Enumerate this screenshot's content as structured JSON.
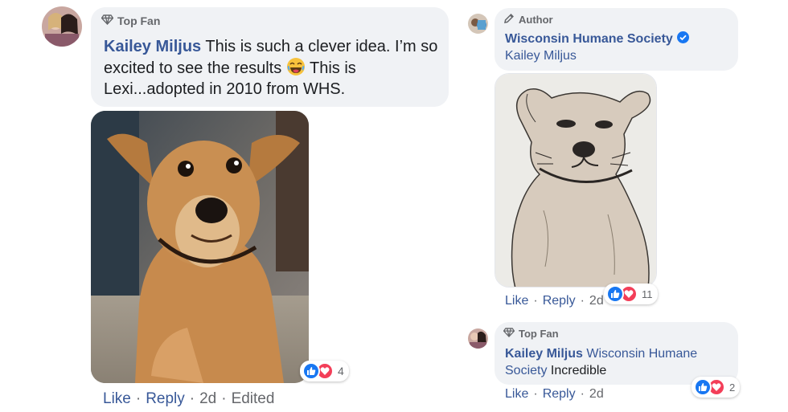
{
  "left_comment": {
    "badge": "Top Fan",
    "author": "Kailey Miljus",
    "text_part1": " This is such a clever idea. I’m so excited to see the results ",
    "text_part2": " This is Lexi...adopted in 2010 from WHS.",
    "emoji": "😂",
    "reaction_count": "4",
    "actions": {
      "like": "Like",
      "reply": "Reply",
      "time": "2d",
      "edited": "Edited"
    }
  },
  "right_comment": {
    "badge": "Author",
    "author": "Wisconsin Humane Society",
    "verified": true,
    "mention": "Kailey Miljus",
    "reaction_count": "11",
    "actions": {
      "like": "Like",
      "reply": "Reply",
      "time": "2d"
    }
  },
  "reply_comment": {
    "badge": "Top Fan",
    "author": "Kailey Miljus",
    "mention": "Wisconsin Humane Society",
    "text": " Incredible",
    "reaction_count": "2",
    "actions": {
      "like": "Like",
      "reply": "Reply",
      "time": "2d"
    }
  },
  "colors": {
    "link": "#385898",
    "bubble": "#f0f2f5",
    "like": "#1877f2",
    "love": "#f33e58"
  }
}
